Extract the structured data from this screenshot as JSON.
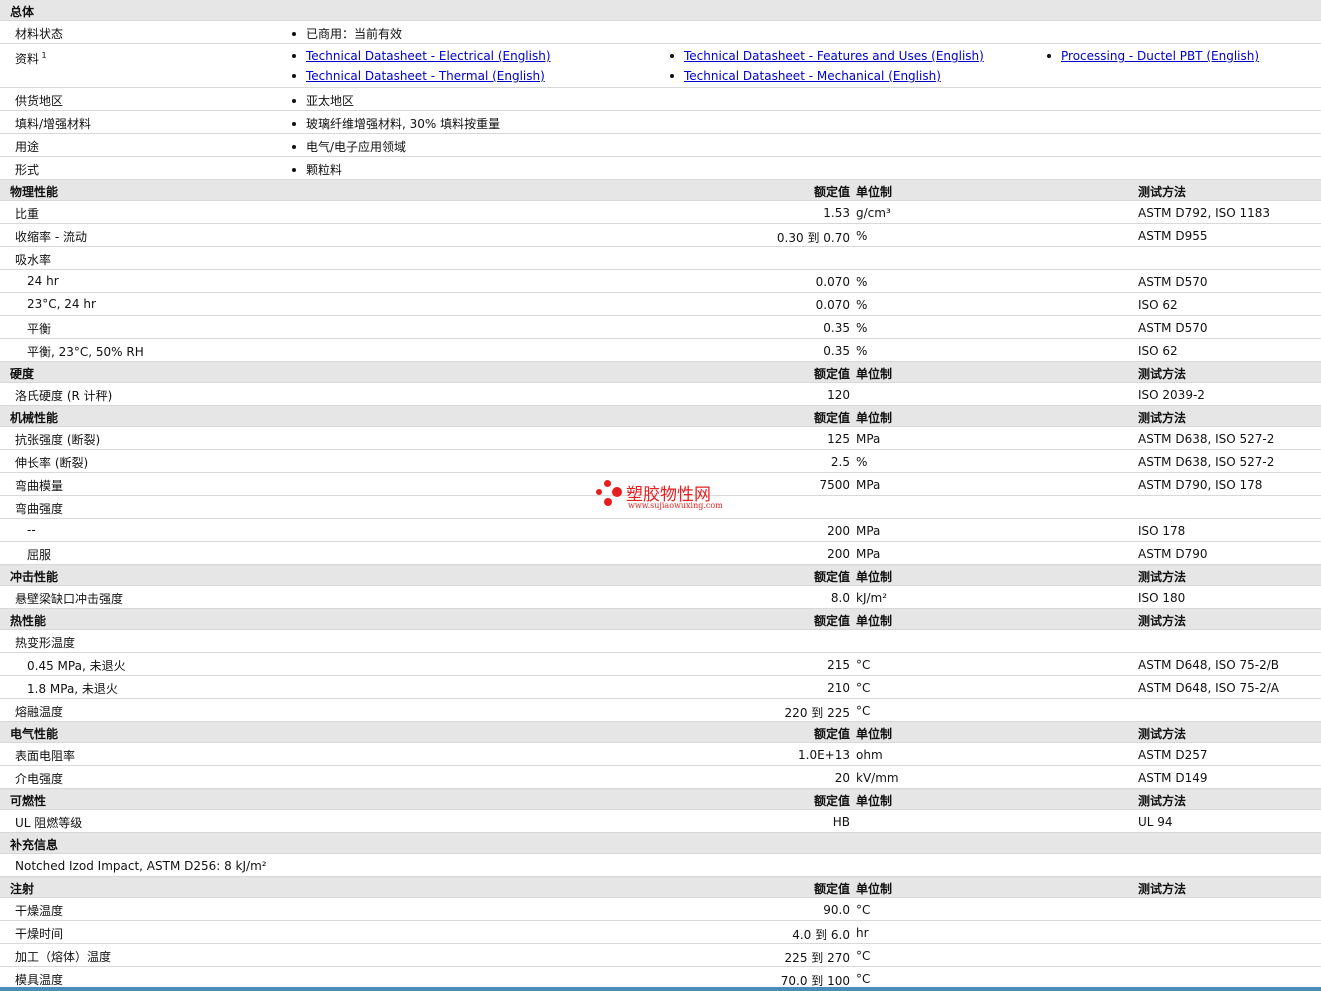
{
  "general": {
    "title": "总体",
    "rows": [
      {
        "label": "材料状态",
        "items": [
          [
            "已商用：当前有效"
          ]
        ]
      },
      {
        "label": "资料",
        "sup": "1",
        "links": [
          [
            "Technical Datasheet - Electrical (English)",
            "Technical Datasheet - Features and Uses (English)",
            "Processing - Ductel PBT (English)"
          ],
          [
            "Technical Datasheet - Thermal (English)",
            "Technical Datasheet - Mechanical (English)"
          ]
        ]
      },
      {
        "label": "供货地区",
        "items": [
          [
            "亚太地区"
          ]
        ]
      },
      {
        "label": "填料/增强材料",
        "items": [
          [
            "玻璃纤维增强材料, 30% 填料按重量"
          ]
        ]
      },
      {
        "label": "用途",
        "items": [
          [
            "电气/电子应用领域"
          ]
        ]
      },
      {
        "label": "形式",
        "items": [
          [
            "颗粒料"
          ]
        ]
      }
    ]
  },
  "headers": {
    "value": "额定值",
    "unit": "单位制",
    "method": "测试方法"
  },
  "sections": [
    {
      "title": "物理性能",
      "rows": [
        {
          "label": "比重",
          "value": "1.53",
          "unit": "g/cm³",
          "method": "ASTM D792, ISO 1183"
        },
        {
          "label": "收缩率  - 流动",
          "value": "0.30 到  0.70",
          "unit": "%",
          "method": "ASTM D955"
        },
        {
          "label": "吸水率"
        },
        {
          "label": "24 hr",
          "indent": true,
          "value": "0.070",
          "unit": "%",
          "method": "ASTM D570"
        },
        {
          "label": "23°C, 24 hr",
          "indent": true,
          "value": "0.070",
          "unit": "%",
          "method": "ISO 62"
        },
        {
          "label": "平衡",
          "indent": true,
          "value": "0.35",
          "unit": "%",
          "method": "ASTM D570"
        },
        {
          "label": "平衡, 23°C, 50% RH",
          "indent": true,
          "value": "0.35",
          "unit": "%",
          "method": "ISO 62"
        }
      ]
    },
    {
      "title": "硬度",
      "rows": [
        {
          "label": "洛氏硬度 (R 计秤)",
          "value": "120",
          "unit": "",
          "method": "ISO 2039-2"
        }
      ]
    },
    {
      "title": "机械性能",
      "rows": [
        {
          "label": "抗张强度 (断裂)",
          "value": "125",
          "unit": "MPa",
          "method": "ASTM D638, ISO 527-2"
        },
        {
          "label": "伸长率 (断裂)",
          "value": "2.5",
          "unit": "%",
          "method": "ASTM D638, ISO 527-2"
        },
        {
          "label": "弯曲模量",
          "value": "7500",
          "unit": "MPa",
          "method": "ASTM D790, ISO 178"
        },
        {
          "label": "弯曲强度"
        },
        {
          "label": "--",
          "indent": true,
          "value": "200",
          "unit": "MPa",
          "method": "ISO 178"
        },
        {
          "label": "屈服",
          "indent": true,
          "value": "200",
          "unit": "MPa",
          "method": "ASTM D790"
        }
      ]
    },
    {
      "title": "冲击性能",
      "rows": [
        {
          "label": "悬壁梁缺口冲击强度",
          "value": "8.0",
          "unit": "kJ/m²",
          "method": "ISO 180"
        }
      ]
    },
    {
      "title": "热性能",
      "rows": [
        {
          "label": "热变形温度"
        },
        {
          "label": "0.45 MPa, 未退火",
          "indent": true,
          "value": "215",
          "unit": "°C",
          "method": "ASTM D648, ISO 75-2/B"
        },
        {
          "label": "1.8 MPa, 未退火",
          "indent": true,
          "value": "210",
          "unit": "°C",
          "method": "ASTM D648, ISO 75-2/A"
        },
        {
          "label": "熔融温度",
          "value": "220 到  225",
          "unit": "°C",
          "method": ""
        }
      ]
    },
    {
      "title": "电气性能",
      "rows": [
        {
          "label": "表面电阻率",
          "value": "1.0E+13",
          "unit": "ohm",
          "method": "ASTM D257"
        },
        {
          "label": "介电强度",
          "value": "20",
          "unit": "kV/mm",
          "method": "ASTM D149"
        }
      ]
    },
    {
      "title": "可燃性",
      "rows": [
        {
          "label": "UL 阻燃等级",
          "value": "HB",
          "unit": "",
          "method": "UL 94"
        }
      ]
    }
  ],
  "supplement": {
    "title": "补充信息",
    "text": "Notched Izod Impact, ASTM D256: 8 kJ/m²"
  },
  "injection": {
    "title": "注射",
    "rows": [
      {
        "label": "干燥温度",
        "value": "90.0",
        "unit": "°C"
      },
      {
        "label": "干燥时间",
        "value": "4.0 到  6.0",
        "unit": "hr"
      },
      {
        "label": "加工（熔体）温度",
        "value": "225 到  270",
        "unit": "°C"
      },
      {
        "label": "模具温度",
        "value": "70.0 到  100",
        "unit": "°C"
      }
    ]
  },
  "watermark": {
    "title": "塑胶物性网",
    "url": "www.sujiaowuxing.com",
    "color": "#e61e1e"
  }
}
